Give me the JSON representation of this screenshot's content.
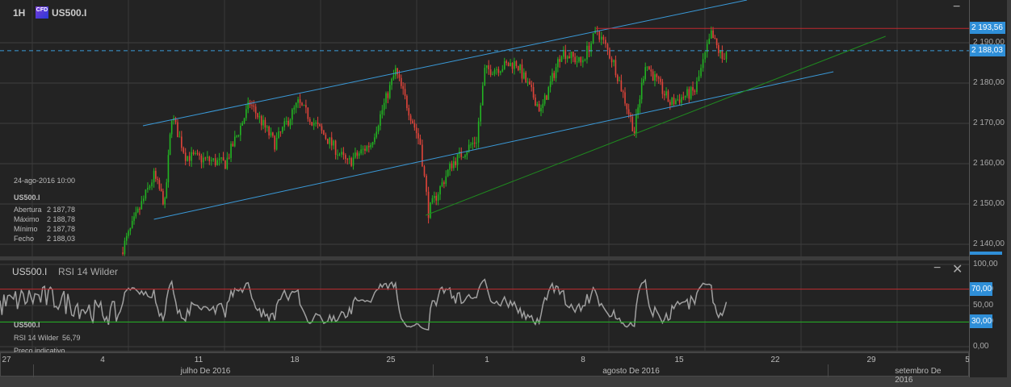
{
  "header": {
    "timeframe": "1H",
    "instrument_badge": "CFD",
    "instrument": "US500.I"
  },
  "info_box": {
    "datetime": "24-ago-2016 10:00",
    "instrument": "US500.I",
    "rows": [
      {
        "label": "Abertura",
        "value": "2 187,78"
      },
      {
        "label": "Máximo",
        "value": "2 188,78"
      },
      {
        "label": "Mínimo",
        "value": "2 187,78"
      },
      {
        "label": "Fecho",
        "value": "2 188,03"
      }
    ]
  },
  "rsi_panel": {
    "instrument": "US500.I",
    "indicator": "RSI 14 Wilder",
    "info_instrument": "US500.I",
    "info_value_label": "RSI 14 Wilder",
    "info_value": "56,79",
    "note": "Preço indicativo"
  },
  "colors": {
    "up": "#22b422",
    "down": "#e0443a",
    "channel": "#3a9ad9",
    "support": "#1f8a1f",
    "resistance": "#c0282e",
    "rsi_line": "#a0a0a0",
    "tag": "#2f8fd8"
  },
  "chart_data": {
    "type": "candlestick",
    "price_ticks": [
      "2 190,00",
      "2 180,00",
      "2 170,00",
      "2 160,00",
      "2 150,00",
      "2 140,00"
    ],
    "price_tick_values": [
      2190,
      2180,
      2170,
      2160,
      2150,
      2140
    ],
    "price_range": [
      2137,
      2201
    ],
    "last_price": "2 188,03",
    "last_price_value": 2188.03,
    "resistance": "2 193,56",
    "resistance_value": 2193.56,
    "x_ticks": [
      {
        "label": "27",
        "day": 0
      },
      {
        "label": "4",
        "day": 7
      },
      {
        "label": "11",
        "day": 14
      },
      {
        "label": "18",
        "day": 21
      },
      {
        "label": "25",
        "day": 28
      },
      {
        "label": "1",
        "day": 35
      },
      {
        "label": "8",
        "day": 42
      },
      {
        "label": "15",
        "day": 49
      },
      {
        "label": "22",
        "day": 56
      },
      {
        "label": "29",
        "day": 63
      },
      {
        "label": "5",
        "day": 70
      }
    ],
    "month_labels": [
      {
        "label": "julho De 2016",
        "day": 14.5
      },
      {
        "label": "agosto De 2016",
        "day": 45.5
      },
      {
        "label": "setembro De 2016",
        "day": 66.5
      }
    ],
    "price_path": [
      [
        8.4,
        2138
      ],
      [
        9.9,
        2150
      ],
      [
        10.8,
        2157
      ],
      [
        11.6,
        2150
      ],
      [
        12.1,
        2172
      ],
      [
        13.1,
        2162
      ],
      [
        16,
        2160
      ],
      [
        17.8,
        2175
      ],
      [
        19.6,
        2165
      ],
      [
        21.3,
        2175
      ],
      [
        24.9,
        2160
      ],
      [
        26.6,
        2165
      ],
      [
        28.4,
        2183
      ],
      [
        30.2,
        2165
      ],
      [
        30.8,
        2148
      ],
      [
        32.5,
        2160
      ],
      [
        34.3,
        2166
      ],
      [
        34.9,
        2183
      ],
      [
        37.2,
        2185
      ],
      [
        39,
        2173
      ],
      [
        40.5,
        2188
      ],
      [
        41.9,
        2185
      ],
      [
        43.1,
        2193
      ],
      [
        44.3,
        2185
      ],
      [
        45.8,
        2168
      ],
      [
        46.6,
        2185
      ],
      [
        48.4,
        2175
      ],
      [
        50.2,
        2178
      ],
      [
        51.4,
        2192
      ],
      [
        52.2,
        2186
      ],
      [
        52.5,
        2188
      ]
    ],
    "trend_lines": [
      {
        "name": "upper-channel",
        "from": [
          10,
          2169.4
        ],
        "to": [
          54,
          2200.6
        ]
      },
      {
        "name": "lower-channel",
        "from": [
          10.8,
          2146.2
        ],
        "to": [
          60.3,
          2182.8
        ]
      },
      {
        "name": "support",
        "from": [
          30.6,
          2147.2
        ],
        "to": [
          64.1,
          2191.6
        ]
      }
    ],
    "rsi_ticks": [
      "100,00",
      "70,00",
      "50,00",
      "30,00",
      "0,00"
    ],
    "rsi_tick_values": [
      100,
      70,
      50,
      30,
      0
    ],
    "rsi_levels": [
      70,
      30
    ]
  }
}
